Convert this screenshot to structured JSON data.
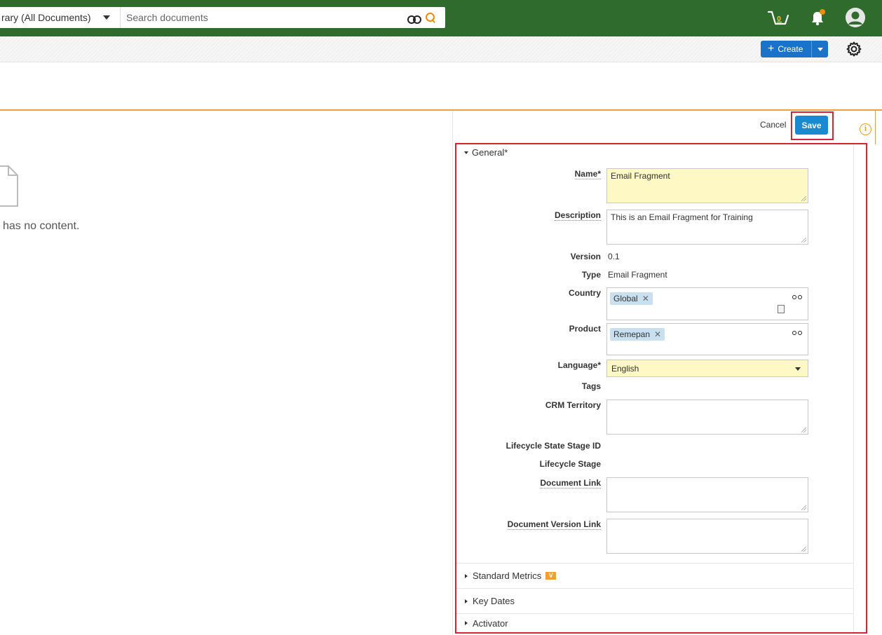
{
  "header": {
    "scope_label": "rary (All Documents)",
    "search_placeholder": "Search documents",
    "cart_count": "0"
  },
  "toolbar": {
    "create_label": "Create"
  },
  "preview": {
    "empty_text": "has no content."
  },
  "panel": {
    "cancel_label": "Cancel",
    "save_label": "Save",
    "info_glyph": "i",
    "general_title": "General*",
    "fields": {
      "name_label": "Name*",
      "name_value": "Email Fragment",
      "description_label": "Description",
      "description_value": "This is an Email Fragment for Training",
      "version_label": "Version",
      "version_value": "0.1",
      "type_label": "Type",
      "type_value": "Email Fragment",
      "country_label": "Country",
      "country_chip": "Global",
      "product_label": "Product",
      "product_chip": "Remepan",
      "chip_remove": "✕",
      "language_label": "Language*",
      "language_value": "English",
      "tags_label": "Tags",
      "crm_label": "CRM Territory",
      "lifecycle_state_stage_id_label": "Lifecycle State Stage ID",
      "lifecycle_stage_label": "Lifecycle Stage",
      "document_link_label": "Document Link",
      "document_version_link_label": "Document Version Link"
    },
    "sections": {
      "standard_metrics": "Standard Metrics",
      "standard_metrics_badge": "V",
      "key_dates": "Key Dates",
      "activator": "Activator"
    }
  },
  "colors": {
    "topbar": "#2f6b2d",
    "accent_orange": "#f0a030",
    "save_blue": "#1a8ad0",
    "create_blue": "#1a73c8",
    "highlight_red": "#d9232f",
    "required_yellow": "#fdf8c4"
  }
}
